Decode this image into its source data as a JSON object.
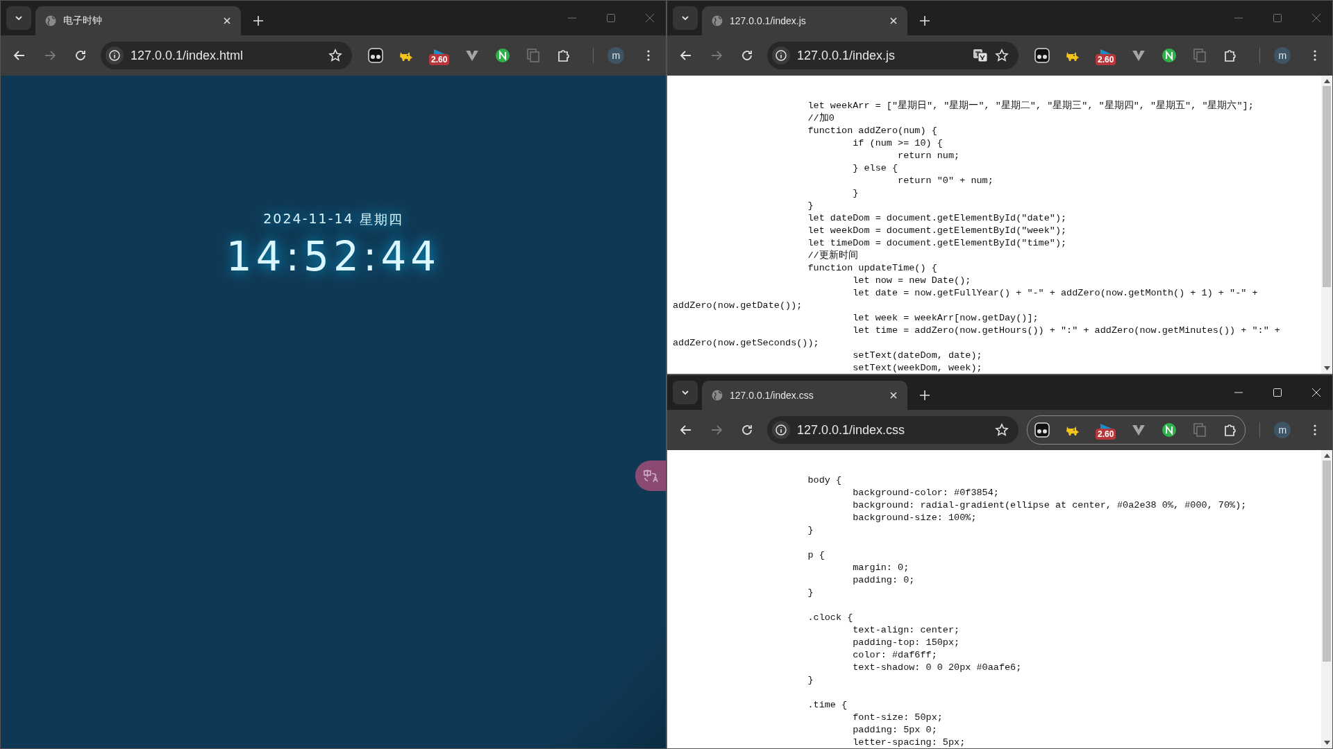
{
  "windows": [
    {
      "kind": "clock",
      "active": false,
      "tab_title": "电子时钟",
      "url": "127.0.0.1/index.html",
      "translate_offered": false,
      "extensions_outlined": false,
      "extension_badge": "2.60",
      "avatar": "m",
      "floating_translate": true,
      "clock": {
        "date": "2024-11-14",
        "weekday": "星期四",
        "time": "14:52:44"
      }
    },
    {
      "kind": "code",
      "active": false,
      "tab_title": "127.0.0.1/index.js",
      "url": "127.0.0.1/index.js",
      "translate_offered": true,
      "extensions_outlined": false,
      "extension_badge": "2.60",
      "avatar": "m",
      "code": "\t\t\tlet weekArr = [\"星期日\", \"星期一\", \"星期二\", \"星期三\", \"星期四\", \"星期五\", \"星期六\"];\n\t\t\t//加0\n\t\t\tfunction addZero(num) {\n\t\t\t\tif (num >= 10) {\n\t\t\t\t\treturn num;\n\t\t\t\t} else {\n\t\t\t\t\treturn \"0\" + num;\n\t\t\t\t}\n\t\t\t}\n\t\t\tlet dateDom = document.getElementById(\"date\");\n\t\t\tlet weekDom = document.getElementById(\"week\");\n\t\t\tlet timeDom = document.getElementById(\"time\");\n\t\t\t//更新时间\n\t\t\tfunction updateTime() {\n\t\t\t\tlet now = new Date();\n\t\t\t\tlet date = now.getFullYear() + \"-\" + addZero(now.getMonth() + 1) + \"-\" +\naddZero(now.getDate());\n\t\t\t\tlet week = weekArr[now.getDay()];\n\t\t\t\tlet time = addZero(now.getHours()) + \":\" + addZero(now.getMinutes()) + \":\" +\naddZero(now.getSeconds());\n\t\t\t\tsetText(dateDom, date);\n\t\t\t\tsetText(weekDom, week);"
    },
    {
      "kind": "code",
      "active": true,
      "tab_title": "127.0.0.1/index.css",
      "url": "127.0.0.1/index.css",
      "translate_offered": false,
      "extensions_outlined": true,
      "extension_badge": "2.60",
      "avatar": "m",
      "code": "\t\t\tbody {\n\t\t\t\tbackground-color: #0f3854;\n\t\t\t\tbackground: radial-gradient(ellipse at center, #0a2e38 0%, #000, 70%);\n\t\t\t\tbackground-size: 100%;\n\t\t\t}\n\n\t\t\tp {\n\t\t\t\tmargin: 0;\n\t\t\t\tpadding: 0;\n\t\t\t}\n\n\t\t\t.clock {\n\t\t\t\ttext-align: center;\n\t\t\t\tpadding-top: 150px;\n\t\t\t\tcolor: #daf6ff;\n\t\t\t\ttext-shadow: 0 0 20px #0aafe6;\n\t\t\t}\n\n\t\t\t.time {\n\t\t\t\tfont-size: 50px;\n\t\t\t\tpadding: 5px 0;\n\t\t\t\tletter-spacing: 5px;"
    }
  ]
}
